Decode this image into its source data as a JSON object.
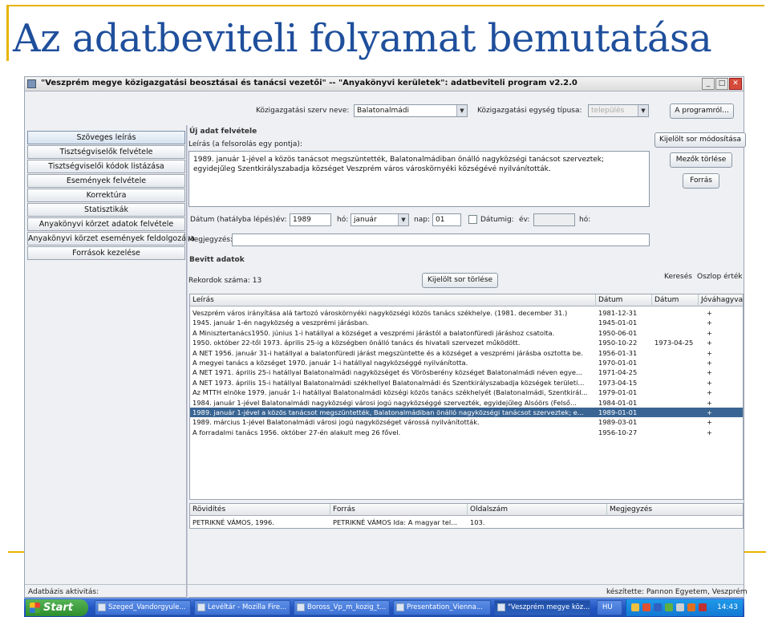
{
  "slide": {
    "title": "Az adatbeviteli folyamat bemutatása"
  },
  "window": {
    "title": "\"Veszprém megye közigazgatási beosztásai és tanácsi vezetői\" -- \"Anyakönyvi kerületek\": adatbeviteli program v2.2.0",
    "min": "_",
    "max": "□",
    "close": "✕"
  },
  "header": {
    "org_label": "Közigazgatási szerv neve:",
    "org_value": "Balatonalmádi",
    "unit_type_label": "Közigazgatási egység típusa:",
    "unit_type_value": "település",
    "about_button": "A programról..."
  },
  "sidebar": {
    "items": [
      {
        "label": "Szöveges leírás"
      },
      {
        "label": "Tisztségviselők felvétele"
      },
      {
        "label": "Tisztségviselői kódok listázása"
      },
      {
        "label": "Események felvétele"
      },
      {
        "label": "Korrektúra"
      },
      {
        "label": "Statisztikák"
      },
      {
        "label": "Anyakönyvi körzet adatok felvétele"
      },
      {
        "label": "Anyakönyvi körzet események feldolgozása"
      },
      {
        "label": "Források kezelése"
      }
    ]
  },
  "form": {
    "new_group": "Új adat felvétele",
    "desc_label": "Leírás (a felsorolás egy pontja):",
    "desc_text": "1989. január 1-jével a közös tanácsot megszüntették, Balatonalmádiban önálló nagyközségi tanácsot szerveztek; egyidejűleg Szentkirályszabadja községet Veszprém város városkörnyéki községévé nyilvánították.",
    "date_label": "Dátum (hatályba lépés):",
    "year_label": "év:",
    "year_value": "1989",
    "month_label": "hó:",
    "month_value": "január",
    "day_label": "nap:",
    "day_value": "01",
    "until_label": "Dátumig:",
    "until_year_label": "év:",
    "until_month_label": "hó:",
    "note_label": "Megjegyzés:",
    "note_value": ""
  },
  "right_buttons": {
    "modify": "Kijelölt sor módosítása",
    "clear": "Mezők törlése",
    "source": "Forrás"
  },
  "records": {
    "group_label": "Bevitt adatok",
    "count_label": "Rekordok száma: 13",
    "delete_button": "Kijelölt sor törlése",
    "search_label": "Keresés",
    "column_value_label": "Oszlop érték",
    "columns": [
      "Leírás",
      "Dátum",
      "Dátum",
      "Jóváhagyva"
    ],
    "rows": [
      {
        "desc": "Veszprém város irányítása alá tartozó városkörnyéki nagyközségi közös tanács székhelye. (1981. december 31.)",
        "date": "1981-12-31",
        "date2": "",
        "ok": "+"
      },
      {
        "desc": "1945. január 1-én nagyközség a veszprémi járásban.",
        "date": "1945-01-01",
        "date2": "",
        "ok": "+"
      },
      {
        "desc": "A Minisztertanács1950. június 1-i hatállyal a községet a veszprémi járástól a balatonfüredi járáshoz csatolta.",
        "date": "1950-06-01",
        "date2": "",
        "ok": "+"
      },
      {
        "desc": "1950. október 22-től 1973. április 25-ig a községben önálló tanács és hivatali szervezet működött.",
        "date": "1950-10-22",
        "date2": "1973-04-25",
        "ok": "+"
      },
      {
        "desc": "A NET 1956. január 31-i hatállyal a balatonfüredi járást megszüntette és a községet a veszprémi járásba osztotta be.",
        "date": "1956-01-31",
        "date2": "",
        "ok": "+"
      },
      {
        "desc": "A megyei tanács a községet 1970. január 1-i hatállyal nagyközséggé nyilvánította.",
        "date": "1970-01-01",
        "date2": "",
        "ok": "+"
      },
      {
        "desc": "A NET 1971. április 25-i hatállyal Balatonalmádi nagyközséget és Vörösberény községet Balatonalmádi néven egye...",
        "date": "1971-04-25",
        "date2": "",
        "ok": "+"
      },
      {
        "desc": "A NET 1973. április 15-i hatállyal Balatonalmádi székhellyel Balatonalmádi és Szentkirályszabadja községek területi...",
        "date": "1973-04-15",
        "date2": "",
        "ok": "+"
      },
      {
        "desc": "Az MTTH elnöke 1979. január 1-i hatállyal Balatonalmádi községi közös tanács székhelyét (Balatonalmádi, Szentkirál...",
        "date": "1979-01-01",
        "date2": "",
        "ok": "+"
      },
      {
        "desc": "1984. január 1-jével Balatonalmádi nagyközségi városi jogú nagyközséggé szervezték, egyidejűleg Alsóörs (Felső...",
        "date": "1984-01-01",
        "date2": "",
        "ok": "+"
      },
      {
        "desc": "1989. január 1-jével a közös tanácsot megszüntették, Balatonalmádiban önálló nagyközségi tanácsot szerveztek; e...",
        "date": "1989-01-01",
        "date2": "",
        "ok": "+"
      },
      {
        "desc": "1989. március 1-jével Balatonalmádi városi jogú nagyközséget várossá nyilvánították.",
        "date": "1989-03-01",
        "date2": "",
        "ok": "+"
      },
      {
        "desc": "A forradalmi tanács 1956. október 27-én alakult meg 26 fővel.",
        "date": "1956-10-27",
        "date2": "",
        "ok": "+"
      }
    ],
    "selected_index": 10
  },
  "sources": {
    "columns": [
      "Rövidítés",
      "Forrás",
      "Oldalszám",
      "Megjegyzés"
    ],
    "rows": [
      {
        "abbr": "PETRIKNÉ VÁMOS, 1996.",
        "source": "PETRIKNÉ VÁMOS Ida: A magyar tel...",
        "page": "103.",
        "note": ""
      }
    ]
  },
  "status": {
    "left": "Adatbázis aktivitás:",
    "right": "készítette: Pannon Egyetem, Veszprém"
  },
  "taskbar": {
    "start": "Start",
    "items": [
      {
        "label": "Szeged_Vandorgyule..."
      },
      {
        "label": "Levéltár - Mozilla Fire..."
      },
      {
        "label": "Boross_Vp_m_kozig_t..."
      },
      {
        "label": "Presentation_Vienna..."
      },
      {
        "label": "\"Veszprém megye köz..."
      }
    ],
    "lang": "HU",
    "clock": "14:43"
  }
}
